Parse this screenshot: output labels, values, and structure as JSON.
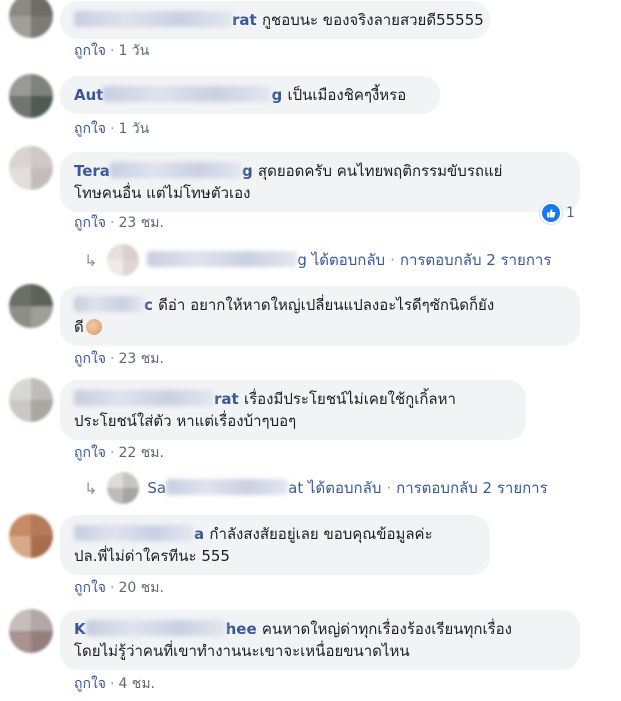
{
  "comments": [
    {
      "author_fragment": "rat",
      "text_lines": [
        "กูชอบนะ ของจริงลายสวยดี55555"
      ],
      "meta": {
        "like": "ถูกใจ",
        "time": "1 วัน"
      }
    },
    {
      "author_fragment": "Aut",
      "author_tail": "g",
      "text_lines": [
        "เป็นเมืองชิคๆงี้หรอ"
      ],
      "meta": {
        "like": "ถูกใจ",
        "time": "1 วัน"
      }
    },
    {
      "author_fragment": "Tera",
      "author_tail": "g",
      "text_lines": [
        "สุดยอดครับ คนไทยพฤติกรรมขับรถแย่",
        "โทษคนอื่น แต่ไม่โทษตัวเอง"
      ],
      "meta": {
        "like": "ถูกใจ",
        "time": "23 ชม."
      },
      "reaction_count": "1",
      "reply": {
        "name_tail": "g",
        "replied": "ได้ตอบกลับ",
        "replies": "การตอบกลับ 2 รายการ"
      }
    },
    {
      "author_fragment": "c",
      "text_lines": [
        "ดีอ่า อยากให้หาดใหญ่เปลี่ยนแปลงอะไรดีๆซักนิดก็ยัง",
        "ดี"
      ],
      "meta": {
        "like": "ถูกใจ",
        "time": "23 ชม."
      }
    },
    {
      "author_fragment": "rat",
      "text_lines": [
        "เรื่องมีประโยชน์ไม่เคยใช้กูเกิ้ลหา",
        "ประโยชน์ใส่ตัว หาแต่เรื่องบ้าๆบอๆ"
      ],
      "meta": {
        "like": "ถูกใจ",
        "time": "22 ชม."
      },
      "reply": {
        "name_head": "Sa",
        "name_tail": "at",
        "replied": "ได้ตอบกลับ",
        "replies": "การตอบกลับ 2 รายการ"
      }
    },
    {
      "author_fragment": "a",
      "text_lines": [
        "กำลังสงสัยอยู่เลย ขอบคุณข้อมูลค่ะ",
        "ปล.พี่ไม่ด่าใครทีนะ 555"
      ],
      "meta": {
        "like": "ถูกใจ",
        "time": "20 ชม."
      }
    },
    {
      "author_fragment": "K",
      "author_tail": "hee",
      "text_lines": [
        "คนหาดใหญ่ด่าทุกเรื่องร้องเรียนทุกเรื่อง",
        "โดยไม่รู้ว่าคนที่เขาทำงานนะเขาจะเหนื่อยขนาดไหน"
      ],
      "meta": {
        "like": "ถูกใจ",
        "time": "4 ชม."
      }
    }
  ],
  "meta_separator": "·",
  "colors": {
    "link": "#385898",
    "bubble": "#f2f3f5",
    "meta": "#616770",
    "reaction": "#1877f2"
  },
  "icons": {
    "reply_arrow": "reply-arrow-icon",
    "like_reaction": "like-reaction-icon",
    "clap_emoji": "clap-emoji-icon"
  }
}
